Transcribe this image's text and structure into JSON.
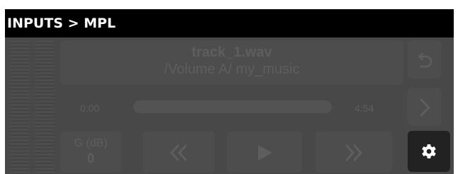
{
  "header": {
    "title": "INPUTS > MPL"
  },
  "track": {
    "name": "track_1.wav",
    "path": "/Volume A/ my_music"
  },
  "playback": {
    "elapsed": "0:00",
    "duration": "4:54",
    "progress": 0.0
  },
  "gain": {
    "label": "G (dB)",
    "value": "0"
  },
  "icons": {
    "back": "undo-arrow-icon",
    "next": "chevron-right-icon",
    "rewind": "rewind-icon",
    "play": "play-icon",
    "forward": "fast-forward-icon",
    "settings": "gear-icon"
  },
  "colors": {
    "background": "#484848",
    "header": "#000000",
    "active_button": "#222222"
  }
}
